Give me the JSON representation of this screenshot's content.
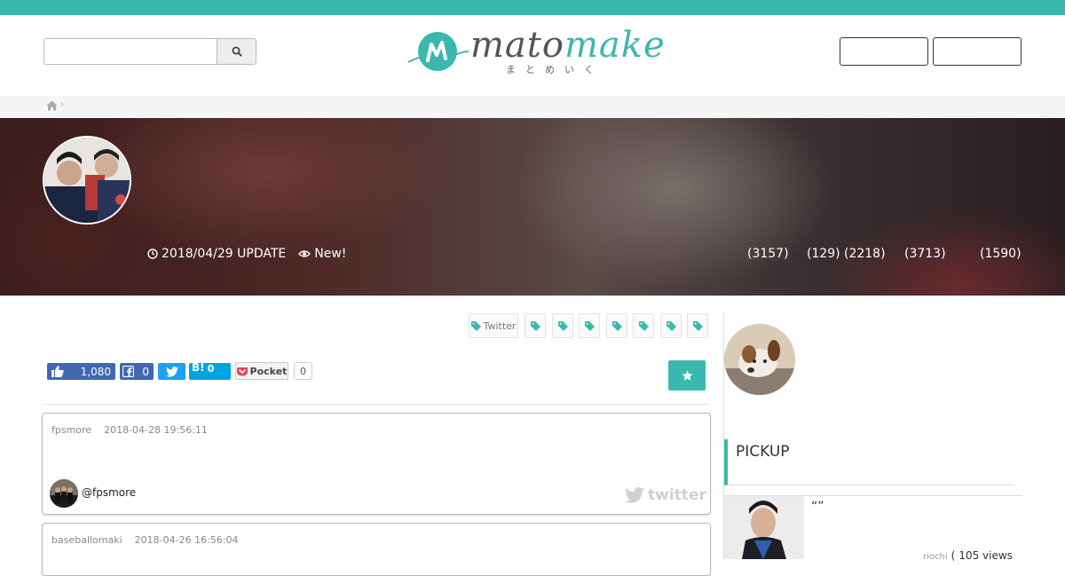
{
  "header": {
    "search": {
      "placeholder": ""
    },
    "logo": {
      "main_dark": "mato",
      "main_accent": "make",
      "sub": "まとめいく"
    },
    "buttons": [
      "",
      ""
    ]
  },
  "hero": {
    "date": "2018/04/29 UPDATE",
    "new_label": "New!",
    "stats": [
      "(3157)",
      "(129)",
      "(2218)",
      "(3713)",
      "(1590)"
    ]
  },
  "tags": [
    "Twitter",
    "",
    "",
    "",
    "",
    "",
    "",
    ""
  ],
  "share": {
    "facebook_like": "1,080",
    "facebook_share": "0",
    "hatena_label": "B!",
    "hatena_count": "0",
    "pocket_label": "Pocket",
    "pocket_count": "0"
  },
  "posts": [
    {
      "user": "fpsmore",
      "date": "2018-04-28 19:56:11",
      "handle": "@fpsmore",
      "source": "twitter"
    },
    {
      "user": "baseballomaki",
      "date": "2018-04-26 16:56:04"
    }
  ],
  "sidebar": {
    "pickup_title": "PICKUP",
    "pickup_item": {
      "title": "“”",
      "user": "riochi",
      "paren": "(",
      "views": "105 views"
    }
  },
  "colors": {
    "accent": "#3ab8ae",
    "facebook": "#4267b2",
    "twitter": "#1da1f2",
    "hatena": "#00a4de"
  }
}
